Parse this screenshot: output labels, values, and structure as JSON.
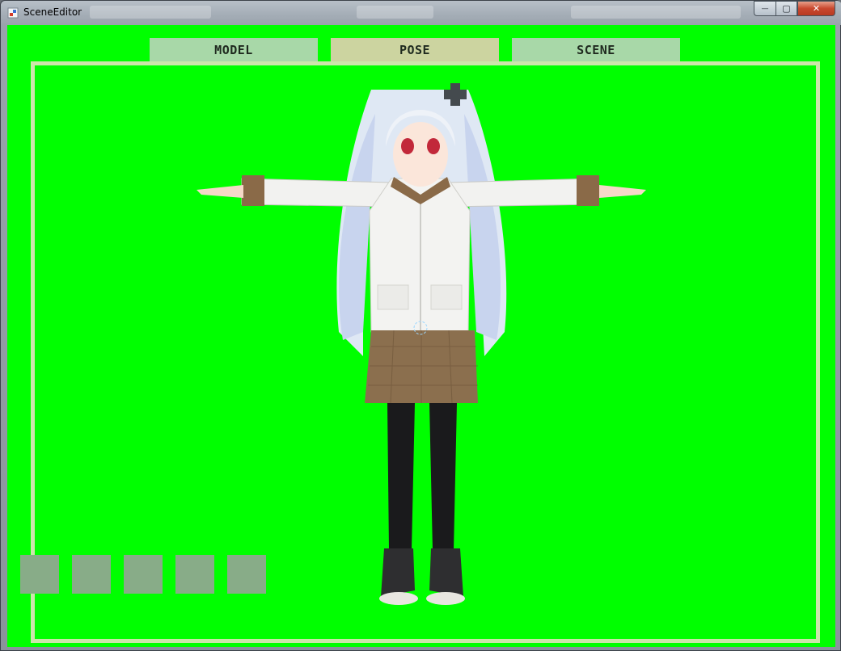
{
  "window": {
    "title": "SceneEditor",
    "controls": {
      "minimize": "—",
      "maximize": "▢",
      "close": "✕"
    }
  },
  "tabs": [
    {
      "label": "MODEL",
      "active": false
    },
    {
      "label": "POSE",
      "active": true
    },
    {
      "label": "SCENE",
      "active": false
    }
  ],
  "viewport": {
    "background_color": "#00ff00",
    "frame_color": "#cde5ab",
    "subject": "3d-anime-girl-model-t-pose"
  },
  "slots": [
    {
      "id": 1
    },
    {
      "id": 2
    },
    {
      "id": 3
    },
    {
      "id": 4
    },
    {
      "id": 5
    }
  ],
  "colors": {
    "tab_inactive": "#a8d8a8",
    "tab_active": "#ccd4a0",
    "slot": "#88ac88"
  }
}
